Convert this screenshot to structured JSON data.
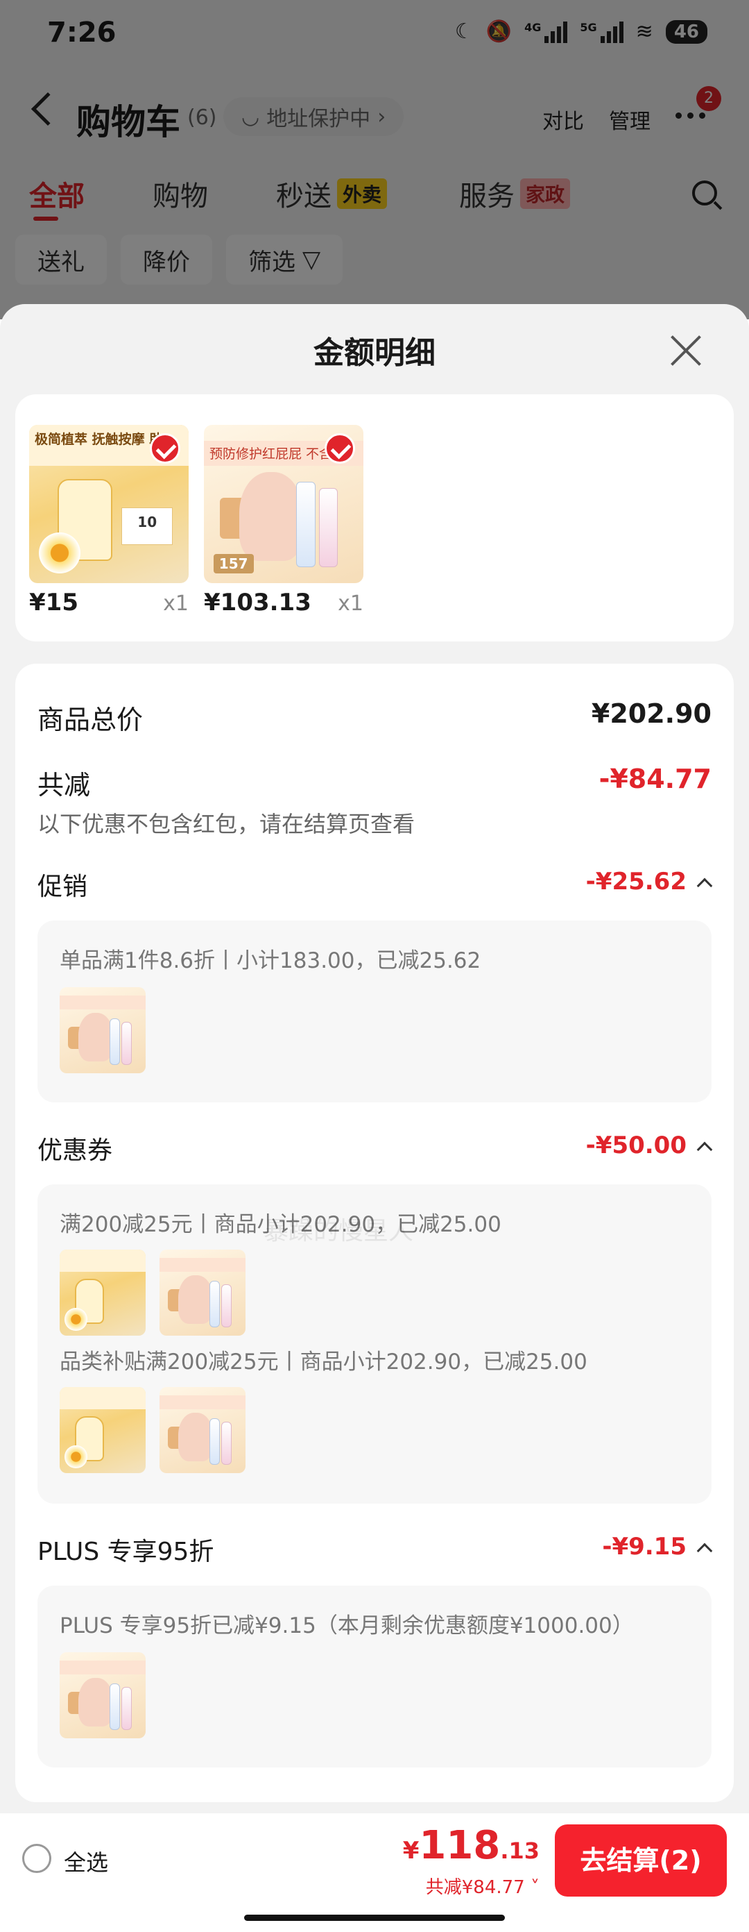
{
  "status_bar": {
    "time": "7:26",
    "net1": "4G",
    "net2": "5G",
    "battery": "46"
  },
  "nav": {
    "title": "购物车",
    "count": "(6)",
    "address_pill": "地址保护中",
    "compare": "对比",
    "manage": "管理",
    "badge": "2"
  },
  "tabs": [
    {
      "label": "全部"
    },
    {
      "label": "购物"
    },
    {
      "label": "秒送",
      "tag": "外卖"
    },
    {
      "label": "服务",
      "tag": "家政"
    }
  ],
  "chips": [
    {
      "label": "送礼"
    },
    {
      "label": "降价"
    },
    {
      "label": "筛选"
    }
  ],
  "sheet": {
    "title": "金额明细",
    "products": [
      {
        "price": "¥15",
        "qty": "x1",
        "art": {
          "header": "极简植萃 抚触按摩 助",
          "tag": "10"
        }
      },
      {
        "price": "¥103.13",
        "qty": "x1",
        "art": {
          "header": "预防修护红屁屁 不含",
          "price_tag": "157"
        }
      }
    ],
    "total_label": "商品总价",
    "total_value": "¥202.90",
    "reduced_label": "共减",
    "reduced_value": "-¥84.77",
    "reduced_note": "以下优惠不包含红包，请在结算页查看",
    "sections": [
      {
        "label": "促销",
        "value": "-¥25.62",
        "rows": [
          {
            "text": "单品满1件8.6折丨小计183.00，已减25.62"
          }
        ]
      },
      {
        "label": "优惠券",
        "value": "-¥50.00",
        "rows": [
          {
            "text": "满200减25元丨商品小计202.90，已减25.00"
          },
          {
            "text": "品类补贴满200减25元丨商品小计202.90，已减25.00"
          }
        ]
      },
      {
        "label": "PLUS 专享95折",
        "value": "-¥9.15",
        "rows": [
          {
            "text": "PLUS 专享95折已减¥9.15（本月剩余优惠额度¥1000.00）"
          }
        ]
      }
    ],
    "watermark": "暴躁的慢星人"
  },
  "bottom": {
    "select_all": "全选",
    "currency": "¥",
    "total_int": "118",
    "total_dec": ".13",
    "saved": "共减¥84.77",
    "checkout": "去结算(2)"
  },
  "colors": {
    "accent": "#e0242b",
    "checkout": "#f5222d"
  }
}
